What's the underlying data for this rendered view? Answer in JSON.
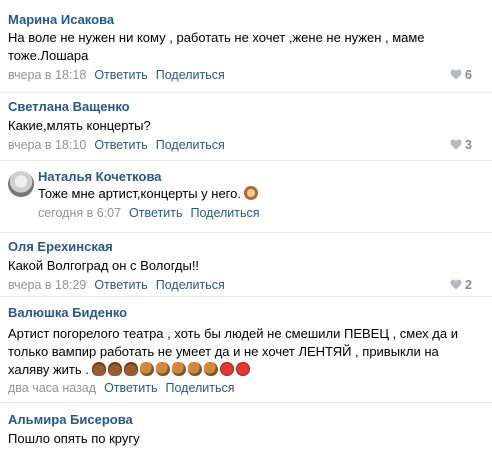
{
  "comments": [
    {
      "author": "Марина Исакова",
      "text": "На воле не нужен ни кому , работать не хочет ,жене не нужен , маме тоже.Лошара",
      "time": "вчера в 18:18",
      "reply": "Ответить",
      "share": "Поделиться",
      "likes": "6"
    },
    {
      "author": "Светлана Ващенко",
      "text": "Какие,млять концерты?",
      "time": "вчера в 18:10",
      "reply": "Ответить",
      "share": "Поделиться",
      "likes": "3"
    },
    {
      "author": "Наталья Кочеткова",
      "text": "Тоже мне артист,концерты у него.",
      "time": "сегодня в 6:07",
      "reply": "Ответить",
      "share": "Поделиться",
      "emoji_icons": [
        "see-no-evil-monkey-icon"
      ]
    },
    {
      "author": "Оля Ерехинская",
      "text": "Какой Волгоград он с Вологды!!",
      "time": "вчера в 18:29",
      "reply": "Ответить",
      "share": "Поделиться",
      "likes": "2"
    },
    {
      "author": "Валюшка Биденко",
      "text_line1": "Артист погорелого театра , хоть бы людей не смешили ПЕВЕЦ , смех да и",
      "text_line2": "только вампир работать не умеет да и не хочет ЛЕНТЯЙ , привыкли на",
      "text_line3": "халяву жить .",
      "emoji_icons": [
        "poop-icon",
        "poop-icon",
        "poop-icon",
        "horse-icon",
        "horse-icon",
        "horse-icon",
        "horse-icon",
        "horse-icon",
        "devil-icon",
        "devil-icon"
      ],
      "time": "два часа назад",
      "reply": "Ответить",
      "share": "Поделиться"
    },
    {
      "author": "Альмира Бисерова",
      "text": "Пошло опять по кругу"
    }
  ],
  "colors": {
    "author_link": "#2a5885",
    "meta_gray": "#939393",
    "divider": "#e7e8ec",
    "heart_gray": "#828a99"
  }
}
